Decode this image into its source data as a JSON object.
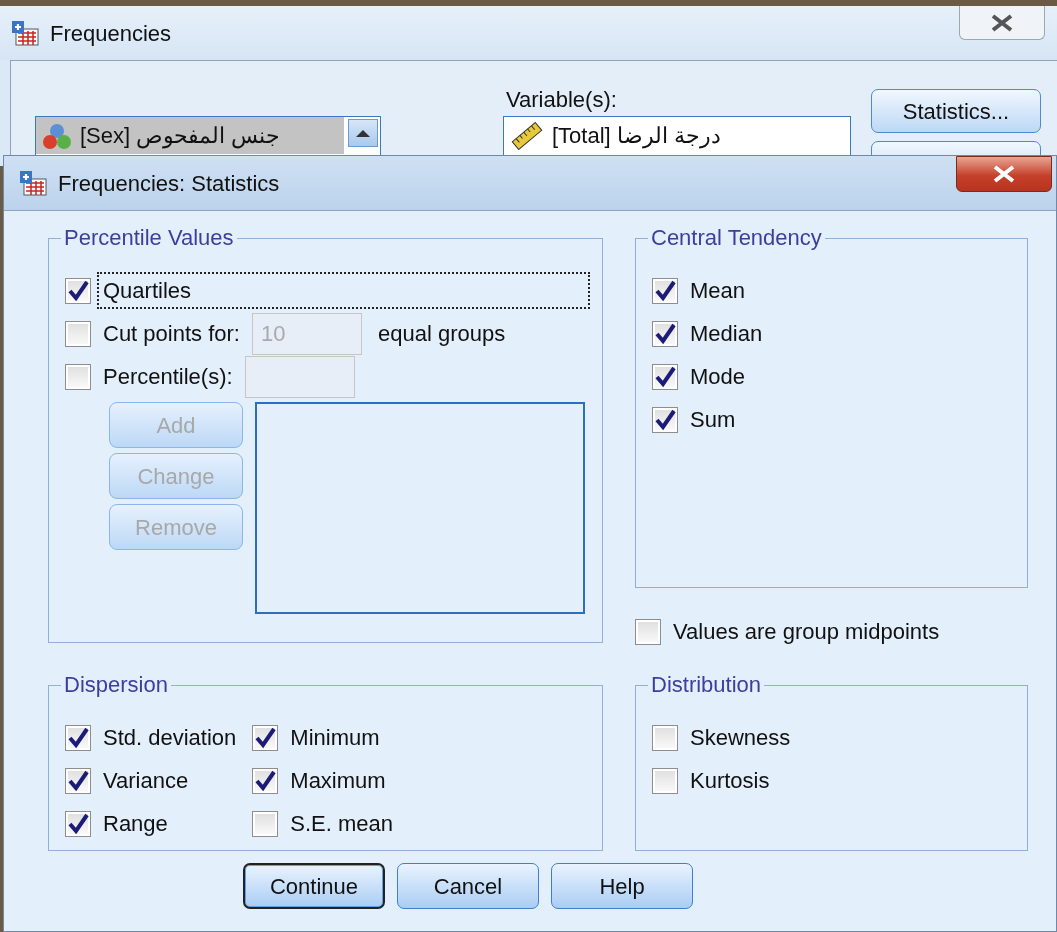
{
  "background_window": {
    "title": "Frequencies",
    "source_list": {
      "items": [
        {
          "text": "[Sex] جنس المفحوص",
          "kind": "nominal",
          "selected": true
        }
      ]
    },
    "variables_label": "Variable(s):",
    "variables_list": {
      "items": [
        {
          "text": "[Total] درجة الرضا",
          "kind": "scale"
        }
      ]
    },
    "buttons": [
      "Statistics..."
    ]
  },
  "dialog": {
    "title": "Frequencies: Statistics",
    "percentile_values": {
      "title": "Percentile Values",
      "options": [
        {
          "label": "Quartiles",
          "checked": true,
          "focused": true
        },
        {
          "label": "Cut points for:",
          "checked": false,
          "focused": false,
          "value": "10",
          "suffix": "equal groups"
        },
        {
          "label": "Percentile(s):",
          "checked": false,
          "focused": false,
          "has_field": true
        }
      ],
      "buttons": [
        {
          "label": "Add",
          "disabled": true
        },
        {
          "label": "Change",
          "disabled": true
        },
        {
          "label": "Remove",
          "disabled": true
        }
      ]
    },
    "central_tendency": {
      "title": "Central Tendency",
      "options": [
        {
          "label": "Mean",
          "checked": true
        },
        {
          "label": "Median",
          "checked": true
        },
        {
          "label": "Mode",
          "checked": true
        },
        {
          "label": "Sum",
          "checked": true
        }
      ]
    },
    "group_midpoints": {
      "label": "Values are group midpoints",
      "checked": false
    },
    "dispersion": {
      "title": "Dispersion",
      "columns": [
        [
          {
            "label": "Std. deviation",
            "checked": true
          },
          {
            "label": "Variance",
            "checked": true
          },
          {
            "label": "Range",
            "checked": true
          }
        ],
        [
          {
            "label": "Minimum",
            "checked": true
          },
          {
            "label": "Maximum",
            "checked": true
          },
          {
            "label": "S.E. mean",
            "checked": false
          }
        ]
      ]
    },
    "distribution": {
      "title": "Distribution",
      "options": [
        {
          "label": "Skewness",
          "checked": false
        },
        {
          "label": "Kurtosis",
          "checked": false
        }
      ]
    },
    "buttons": [
      {
        "label": "Continue",
        "default": true
      },
      {
        "label": "Cancel",
        "default": false
      },
      {
        "label": "Help",
        "default": false
      }
    ]
  }
}
